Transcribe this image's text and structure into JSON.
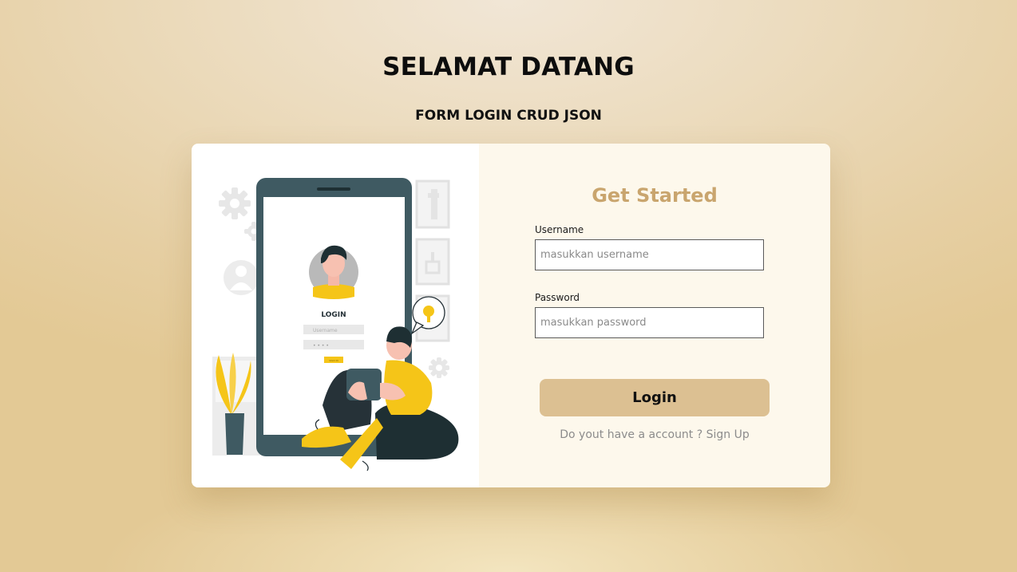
{
  "page": {
    "title": "SELAMAT DATANG",
    "subtitle": "FORM LOGIN CRUD JSON"
  },
  "illustration": {
    "phone_heading": "LOGIN",
    "phone_username_placeholder": "Username",
    "phone_password_mask": "• • • •",
    "phone_button_label": "SIGN IN"
  },
  "form": {
    "heading": "Get Started",
    "username": {
      "label": "Username",
      "placeholder": "masukkan username",
      "value": ""
    },
    "password": {
      "label": "Password",
      "placeholder": "masukkan password",
      "value": ""
    },
    "login_button": "Login",
    "signup_prompt": "Do yout have a account ?",
    "signup_link": "Sign Up"
  },
  "colors": {
    "background": "#e6cfa3",
    "accent_heading": "#c9a56e",
    "button": "#dcc092",
    "form_panel": "#fdf8ec",
    "illustration_yellow": "#f5c518",
    "illustration_dark": "#3f5a62"
  },
  "icons": {
    "gear": "gear-icon",
    "user_silhouette": "user-silhouette-icon",
    "key_bubble": "key-speech-bubble-icon",
    "plant": "potted-plant-icon"
  }
}
